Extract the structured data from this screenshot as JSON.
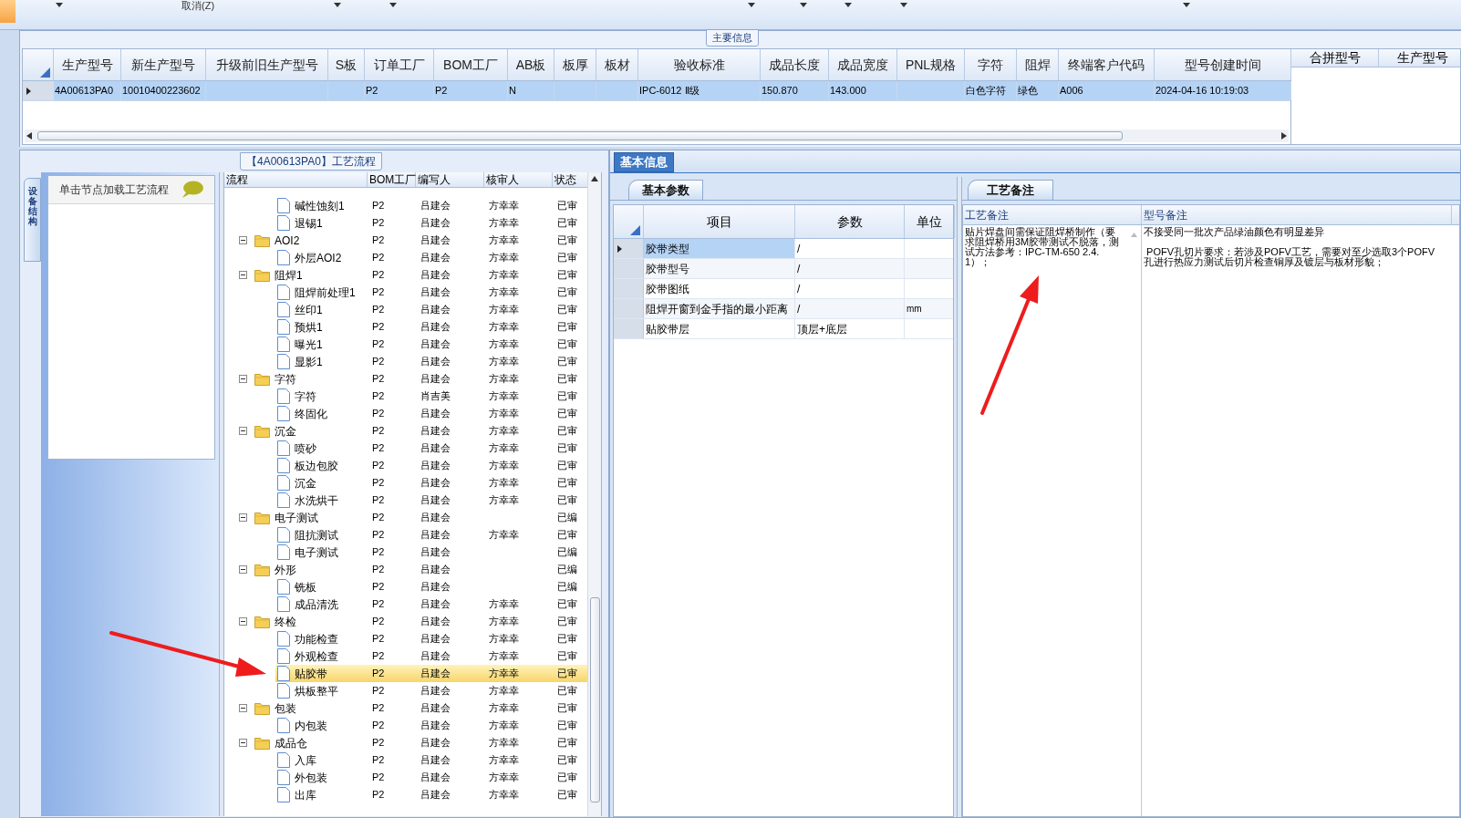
{
  "toolbar": {
    "cancel_label": "取消(Z)"
  },
  "main_info": {
    "caption": "主要信息",
    "columns": [
      "生产型号",
      "新生产型号",
      "升级前旧生产型号",
      "S板",
      "订单工厂",
      "BOM工厂",
      "AB板",
      "板厚",
      "板材",
      "验收标准",
      "成品长度",
      "成品宽度",
      "PNL规格",
      "字符",
      "阻焊",
      "终端客户代码",
      "型号创建时间"
    ],
    "rows": [
      {
        "selected": true,
        "cells": [
          "4A00613PA0",
          "10010400223602",
          "",
          "",
          "P2",
          "P2",
          "N",
          "",
          "",
          "IPC-6012 Ⅱ级",
          "150.870",
          "143.000",
          "",
          "白色字符",
          "绿色",
          "A006",
          "2024-04-16 10:19:03"
        ]
      }
    ],
    "side_columns": [
      "合拼型号",
      "生产型号"
    ]
  },
  "process": {
    "caption": "【4A00613PA0】工艺流程",
    "side_tab": "设备结构",
    "hint": "单击节点加载工艺流程",
    "columns": [
      "流程",
      "BOM工厂",
      "编写人",
      "核审人",
      "状态"
    ],
    "tree": [
      {
        "children": [
          {
            "label": "碱性蚀刻1",
            "bom": "P2",
            "writer": "吕建会",
            "reviewer": "方幸幸",
            "status": "已审",
            "selected": false
          },
          {
            "label": "退锡1",
            "bom": "P2",
            "writer": "吕建会",
            "reviewer": "方幸幸",
            "status": "已审",
            "selected": false
          }
        ]
      },
      {
        "label": "AOI2",
        "bom": "P2",
        "writer": "吕建会",
        "reviewer": "方幸幸",
        "status": "已审",
        "selected": false,
        "expanded": true,
        "children": [
          {
            "label": "外层AOI2",
            "bom": "P2",
            "writer": "吕建会",
            "reviewer": "方幸幸",
            "status": "已审",
            "selected": false
          }
        ]
      },
      {
        "label": "阻焊1",
        "bom": "P2",
        "writer": "吕建会",
        "reviewer": "方幸幸",
        "status": "已审",
        "selected": false,
        "expanded": true,
        "children": [
          {
            "label": "阻焊前处理1",
            "bom": "P2",
            "writer": "吕建会",
            "reviewer": "方幸幸",
            "status": "已审",
            "selected": false
          },
          {
            "label": "丝印1",
            "bom": "P2",
            "writer": "吕建会",
            "reviewer": "方幸幸",
            "status": "已审",
            "selected": false
          },
          {
            "label": "预烘1",
            "bom": "P2",
            "writer": "吕建会",
            "reviewer": "方幸幸",
            "status": "已审",
            "selected": false
          },
          {
            "label": "曝光1",
            "bom": "P2",
            "writer": "吕建会",
            "reviewer": "方幸幸",
            "status": "已审",
            "selected": false
          },
          {
            "label": "显影1",
            "bom": "P2",
            "writer": "吕建会",
            "reviewer": "方幸幸",
            "status": "已审",
            "selected": false
          }
        ]
      },
      {
        "label": "字符",
        "bom": "P2",
        "writer": "吕建会",
        "reviewer": "方幸幸",
        "status": "已审",
        "selected": false,
        "expanded": true,
        "children": [
          {
            "label": "字符",
            "bom": "P2",
            "writer": "肖吉美",
            "reviewer": "方幸幸",
            "status": "已审",
            "selected": false
          },
          {
            "label": "终固化",
            "bom": "P2",
            "writer": "吕建会",
            "reviewer": "方幸幸",
            "status": "已审",
            "selected": false
          }
        ]
      },
      {
        "label": "沉金",
        "bom": "P2",
        "writer": "吕建会",
        "reviewer": "方幸幸",
        "status": "已审",
        "selected": false,
        "expanded": true,
        "children": [
          {
            "label": "喷砂",
            "bom": "P2",
            "writer": "吕建会",
            "reviewer": "方幸幸",
            "status": "已审",
            "selected": false
          },
          {
            "label": "板边包胶",
            "bom": "P2",
            "writer": "吕建会",
            "reviewer": "方幸幸",
            "status": "已审",
            "selected": false
          },
          {
            "label": "沉金",
            "bom": "P2",
            "writer": "吕建会",
            "reviewer": "方幸幸",
            "status": "已审",
            "selected": false
          },
          {
            "label": "水洗烘干",
            "bom": "P2",
            "writer": "吕建会",
            "reviewer": "方幸幸",
            "status": "已审",
            "selected": false
          }
        ]
      },
      {
        "label": "电子测试",
        "bom": "P2",
        "writer": "吕建会",
        "status": "已编",
        "selected": false,
        "expanded": true,
        "children": [
          {
            "label": "阻抗测试",
            "bom": "P2",
            "writer": "吕建会",
            "reviewer": "方幸幸",
            "status": "已审",
            "selected": false
          },
          {
            "label": "电子测试",
            "bom": "P2",
            "writer": "吕建会",
            "status": "已编",
            "selected": false
          }
        ]
      },
      {
        "label": "外形",
        "bom": "P2",
        "writer": "吕建会",
        "status": "已编",
        "selected": false,
        "expanded": true,
        "children": [
          {
            "label": "铣板",
            "bom": "P2",
            "writer": "吕建会",
            "status": "已编",
            "selected": false
          },
          {
            "label": "成品清洗",
            "bom": "P2",
            "writer": "吕建会",
            "reviewer": "方幸幸",
            "status": "已审",
            "selected": false
          }
        ]
      },
      {
        "label": "终检",
        "bom": "P2",
        "writer": "吕建会",
        "reviewer": "方幸幸",
        "status": "已审",
        "selected": false,
        "expanded": true,
        "children": [
          {
            "label": "功能检查",
            "bom": "P2",
            "writer": "吕建会",
            "reviewer": "方幸幸",
            "status": "已审",
            "selected": false
          },
          {
            "label": "外观检查",
            "bom": "P2",
            "writer": "吕建会",
            "reviewer": "方幸幸",
            "status": "已审",
            "selected": false
          },
          {
            "label": "贴胶带",
            "bom": "P2",
            "writer": "吕建会",
            "reviewer": "方幸幸",
            "status": "已审",
            "selected": true
          },
          {
            "label": "烘板整平",
            "bom": "P2",
            "writer": "吕建会",
            "reviewer": "方幸幸",
            "status": "已审",
            "selected": false
          }
        ]
      },
      {
        "label": "包装",
        "bom": "P2",
        "writer": "吕建会",
        "reviewer": "方幸幸",
        "status": "已审",
        "selected": false,
        "expanded": true,
        "children": [
          {
            "label": "内包装",
            "bom": "P2",
            "writer": "吕建会",
            "reviewer": "方幸幸",
            "status": "已审",
            "selected": false
          }
        ]
      },
      {
        "label": "成品仓",
        "bom": "P2",
        "writer": "吕建会",
        "reviewer": "方幸幸",
        "status": "已审",
        "selected": false,
        "expanded": true,
        "children": [
          {
            "label": "入库",
            "bom": "P2",
            "writer": "吕建会",
            "reviewer": "方幸幸",
            "status": "已审",
            "selected": false
          },
          {
            "label": "外包装",
            "bom": "P2",
            "writer": "吕建会",
            "reviewer": "方幸幸",
            "status": "已审",
            "selected": false
          },
          {
            "label": "出库",
            "bom": "P2",
            "writer": "吕建会",
            "reviewer": "方幸幸",
            "status": "已审",
            "selected": false
          }
        ]
      }
    ]
  },
  "basic_info": {
    "tab": "基本信息",
    "params_tab": "基本参数",
    "columns": [
      "项目",
      "参数",
      "单位"
    ],
    "rows": [
      {
        "item": "胶带类型",
        "param": "/",
        "selected": true
      },
      {
        "item": "胶带型号",
        "param": "/",
        "selected": false
      },
      {
        "item": "胶带图纸",
        "param": "/",
        "selected": false
      },
      {
        "item": "阻焊开窗到金手指的最小距离",
        "param": "/",
        "unit": "mm",
        "selected": false
      },
      {
        "item": "贴胶带层",
        "param": "顶层+底层",
        "selected": false
      }
    ],
    "remarks_tab": "工艺备注",
    "remark_columns": [
      "工艺备注",
      "型号备注"
    ],
    "process_remark": "贴片焊盘间需保证阻焊桥制作（要求阻焊桥用3M胶带测试不脱落，测试方法参考：IPC-TM-650 2.4.1）；",
    "model_remarks": [
      "不接受同一批次产品绿油颜色有明显差异",
      " POFV孔切片要求：若涉及POFV工艺，需要对至少选取3个POFV孔进行热应力测试后切片检查铜厚及镀层与板材形貌；"
    ]
  }
}
